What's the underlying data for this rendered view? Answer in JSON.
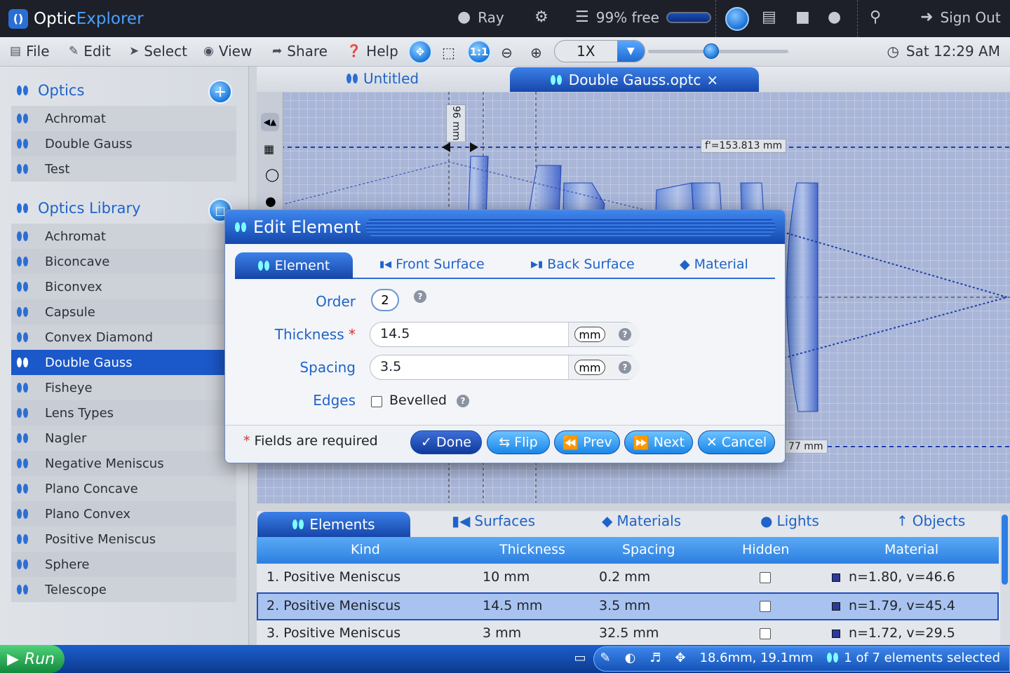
{
  "app": {
    "name_part1": "Optic",
    "name_part2": "Explorer"
  },
  "topbar": {
    "user": "Ray",
    "storage": "99% free",
    "signout": "Sign Out"
  },
  "menu": {
    "file": "File",
    "edit": "Edit",
    "select": "Select",
    "view": "View",
    "share": "Share",
    "help": "Help",
    "one_to_one": "1:1",
    "zoom_value": "1X",
    "zoom_slider_fraction": 0.45,
    "clock": "Sat 12:29 AM"
  },
  "sidebar": {
    "optics_title": "Optics",
    "optics": [
      "Achromat",
      "Double Gauss",
      "Test"
    ],
    "library_title": "Optics Library",
    "library": [
      "Achromat",
      "Biconcave",
      "Biconvex",
      "Capsule",
      "Convex Diamond",
      "Double Gauss",
      "Fisheye",
      "Lens Types",
      "Nagler",
      "Negative Meniscus",
      "Plano Concave",
      "Plano Convex",
      "Positive Meniscus",
      "Sphere",
      "Telescope"
    ],
    "selected_library_item": "Double Gauss"
  },
  "tabs": {
    "untitled": "Untitled",
    "active": "Double Gauss.optc",
    "close": "×"
  },
  "canvas": {
    "focal_label": "f'=153.813 mm",
    "dim_label": "96 mm",
    "partial_label": "77 mm"
  },
  "dialog": {
    "title": "Edit Element",
    "tabs": [
      "Element",
      "Front Surface",
      "Back Surface",
      "Material"
    ],
    "order_label": "Order",
    "order_value": "2",
    "thickness_label": "Thickness",
    "thickness_value": "14.5",
    "thickness_unit": "mm",
    "spacing_label": "Spacing",
    "spacing_value": "3.5",
    "spacing_unit": "mm",
    "edges_label": "Edges",
    "bevelled_label": "Bevelled",
    "required_star": "*",
    "required_note": "Fields are required",
    "buttons": {
      "done": "Done",
      "flip": "Flip",
      "prev": "Prev",
      "next": "Next",
      "cancel": "Cancel"
    }
  },
  "bottom": {
    "tabs": [
      "Elements",
      "Surfaces",
      "Materials",
      "Lights",
      "Objects"
    ],
    "columns": [
      "Kind",
      "Thickness",
      "Spacing",
      "Hidden",
      "Material"
    ],
    "rows": [
      {
        "kind": "1. Positive Meniscus",
        "thickness": "10 mm",
        "spacing": "0.2 mm",
        "material": "n=1.80, v=46.6"
      },
      {
        "kind": "2. Positive Meniscus",
        "thickness": "14.5 mm",
        "spacing": "3.5 mm",
        "material": "n=1.79, v=45.4"
      },
      {
        "kind": "3. Positive Meniscus",
        "thickness": "3 mm",
        "spacing": "32.5 mm",
        "material": "n=1.72, v=29.5"
      }
    ]
  },
  "status": {
    "run": "Run",
    "coords": "18.6mm, 19.1mm",
    "selection": "1 of 7 elements selected"
  },
  "colors": {
    "accent": "#1f63c9",
    "selected": "#1b58c9",
    "topbar": "#1d2029"
  }
}
